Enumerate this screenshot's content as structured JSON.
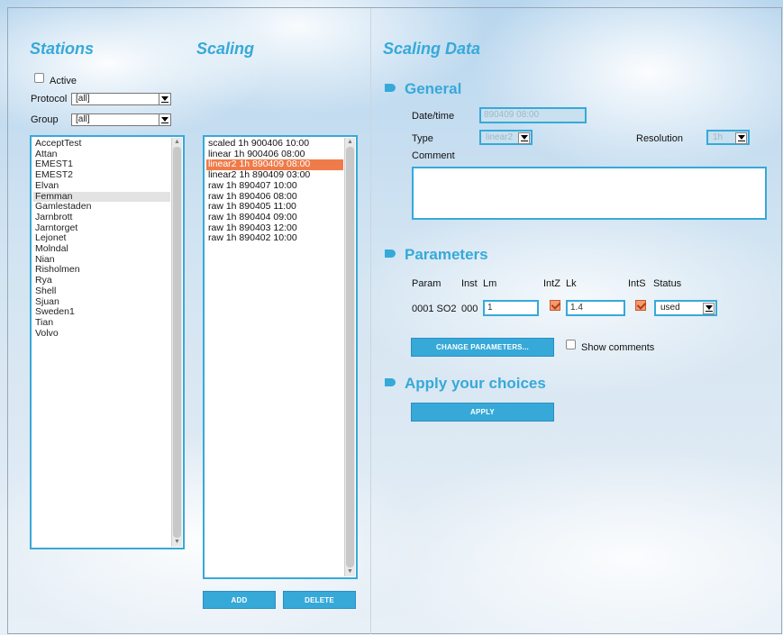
{
  "stations": {
    "title": "Stations",
    "active_label": "Active",
    "protocol_label": "Protocol",
    "protocol_value": "[all]",
    "group_label": "Group",
    "group_value": "[all]",
    "items": [
      "AcceptTest",
      "Attan",
      "EMEST1",
      "EMEST2",
      "Elvan",
      "Femman",
      "Gamlestaden",
      "Jarnbrott",
      "Jarntorget",
      "Lejonet",
      "Molndal",
      "Nian",
      "Risholmen",
      "Rya",
      "Shell",
      "Sjuan",
      "Sweden1",
      "Tian",
      "Volvo"
    ],
    "selected_index": 5
  },
  "scaling": {
    "title": "Scaling",
    "items": [
      "scaled 1h 900406 10:00",
      "linear 1h 900406 08:00",
      "linear2 1h 890409 08:00",
      "linear2 1h 890409 03:00",
      "raw 1h 890407 10:00",
      "raw 1h 890406 08:00",
      "raw 1h 890405 11:00",
      "raw 1h 890404 09:00",
      "raw 1h 890403 12:00",
      "raw 1h 890402 10:00"
    ],
    "selected_index": 2,
    "add_label": "ADD",
    "delete_label": "DELETE"
  },
  "scaling_data": {
    "title": "Scaling Data",
    "general": {
      "heading": "General",
      "datetime_label": "Date/time",
      "datetime_value": "890409 08:00",
      "type_label": "Type",
      "type_value": "linear2",
      "resolution_label": "Resolution",
      "resolution_value": "1h",
      "comment_label": "Comment",
      "comment_value": ""
    },
    "parameters": {
      "heading": "Parameters",
      "col_param": "Param",
      "col_inst": "Inst",
      "col_lm": "Lm",
      "col_intz": "IntZ",
      "col_lk": "Lk",
      "col_ints": "IntS",
      "col_status": "Status",
      "row": {
        "param": "0001 SO2",
        "inst": "000",
        "lm": "1",
        "intz": true,
        "lk": "1.4",
        "ints": true,
        "status": "used"
      },
      "change_label": "CHANGE PARAMETERS...",
      "show_comments_label": "Show comments"
    },
    "apply": {
      "heading": "Apply your choices",
      "button_label": "APPLY"
    }
  },
  "colors": {
    "accent": "#36a9d9",
    "highlight": "#ef7b4a",
    "checkbox_checked": "#f29a72"
  }
}
